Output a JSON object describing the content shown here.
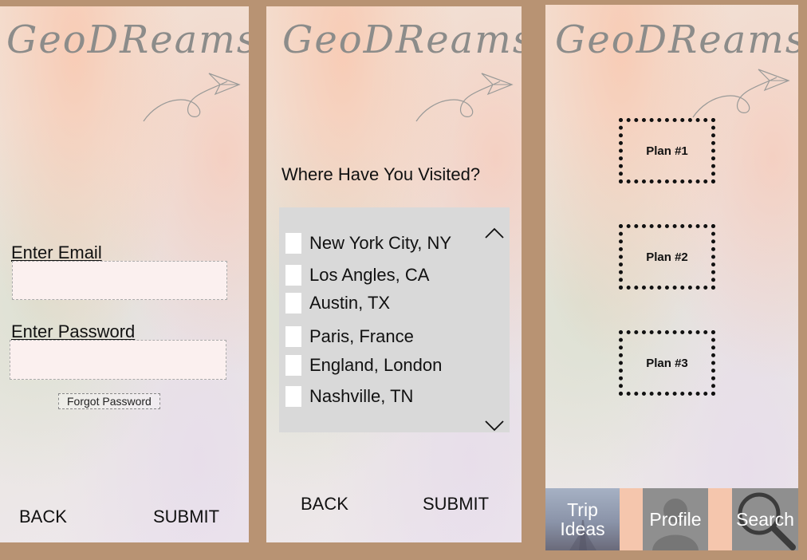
{
  "brand": {
    "logo_text": "GeoDReams"
  },
  "login": {
    "email_label": "Enter Email",
    "email_value": "",
    "password_label": "Enter Password",
    "password_value": "",
    "forgot_label": "Forgot Password",
    "back_label": "BACK",
    "submit_label": "SUBMIT"
  },
  "visited": {
    "question": "Where Have You Visited?",
    "items": [
      {
        "label": "New York City, NY",
        "checked": false
      },
      {
        "label": "Los Angles, CA",
        "checked": false
      },
      {
        "label": "Austin, TX",
        "checked": false
      },
      {
        "label": "Paris, France",
        "checked": false
      },
      {
        "label": "England, London",
        "checked": false
      },
      {
        "label": "Nashville, TN",
        "checked": false
      }
    ],
    "back_label": "BACK",
    "submit_label": "SUBMIT"
  },
  "plans": {
    "items": [
      {
        "label": "Plan #1"
      },
      {
        "label": "Plan #2"
      },
      {
        "label": "Plan #3"
      }
    ]
  },
  "tabbar": {
    "trip_ideas_line1": "Trip",
    "trip_ideas_line2": "Ideas",
    "profile_label": "Profile",
    "search_label": "Search"
  },
  "colors": {
    "frame_bg": "#b89373",
    "accent_peach": "#f5c6ad",
    "list_bg": "#d9d9d9",
    "logo_gray": "#8c8c8a"
  },
  "icons": [
    "paper-plane-icon",
    "chevron-up-icon",
    "chevron-down-icon",
    "person-silhouette-icon",
    "magnifier-icon"
  ]
}
